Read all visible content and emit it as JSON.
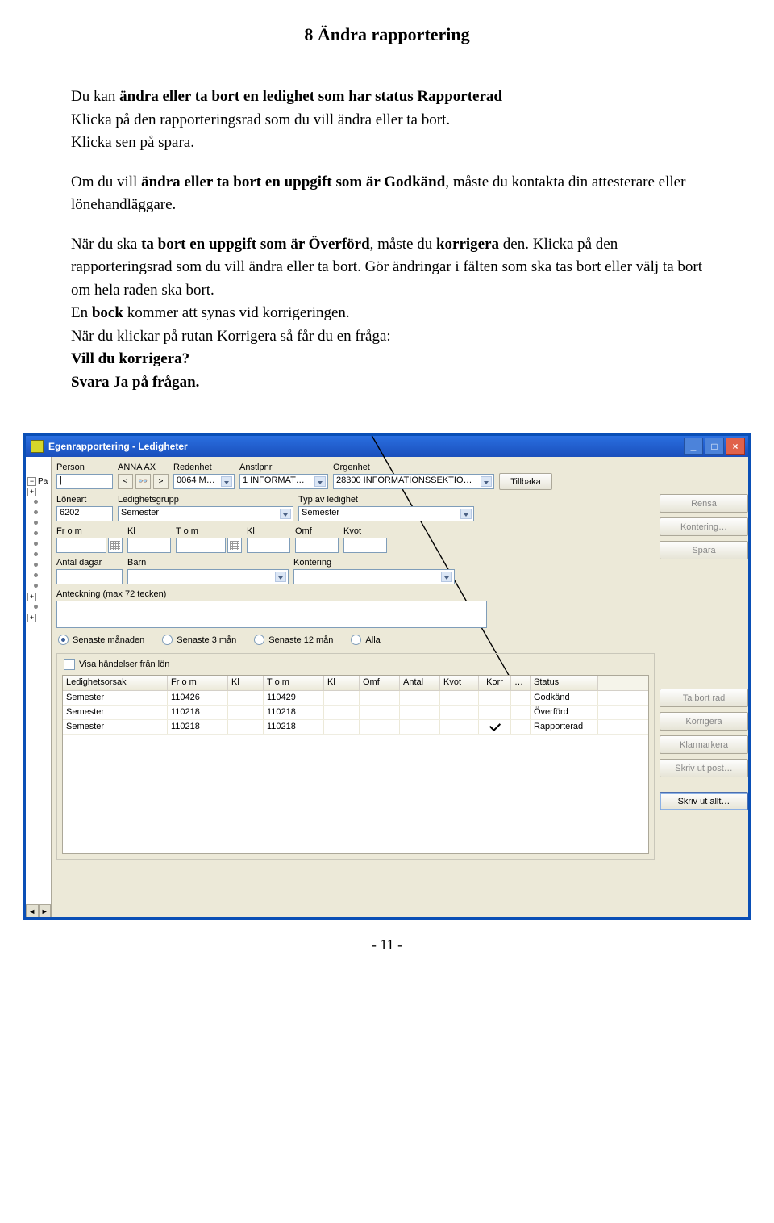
{
  "doc": {
    "heading": "8 Ändra rapportering",
    "p1a": "Du kan ",
    "p1b": "ändra eller ta bort en ledighet som har status Rapporterad",
    "p1c": "",
    "p2": "Klicka på den rapporteringsrad som du vill ändra eller ta bort.",
    "p3": "Klicka sen på spara.",
    "p4a": "Om du vill ",
    "p4b": "ändra eller ta bort en uppgift som är Godkänd",
    "p4c": ", måste du kontakta din attesterare eller lönehandläggare.",
    "p5a": "När du ska ",
    "p5b": "ta bort en uppgift som är Överförd",
    "p5c": ", måste du ",
    "p5d": "korrigera",
    "p5e": " den. Klicka på den rapporteringsrad som du vill ändra eller ta bort. Gör ändringar i fälten som ska tas bort eller välj ta bort om hela raden ska bort.",
    "p6a": "En ",
    "p6b": "bock",
    "p6c": " kommer att synas vid korrigeringen.",
    "p7": "När du klickar på rutan Korrigera så får du en fråga:",
    "p8": "Vill du korrigera?",
    "p9": "Svara Ja på frågan.",
    "footer": "- 11 -"
  },
  "app": {
    "title": "Egenrapportering - Ledigheter",
    "titlebar_icons": {
      "minimize": "_",
      "maximize": "□",
      "close": "×"
    },
    "toolbar": {
      "person_lbl": "Person",
      "person_val": "|",
      "anna": "ANNA AX",
      "prev": "<",
      "binoc": "🔍",
      "next": ">",
      "redenhet_lbl": "Redenhet",
      "redenhet_val": "0064  M…",
      "anstlpnr_lbl": "Anstlpnr",
      "anstlpnr_val": "1   INFORMAT…",
      "orgenhet_lbl": "Orgenhet",
      "orgenhet_val": "28300  INFORMATIONSSEKTIO…",
      "tillbaka": "Tillbaka"
    },
    "form": {
      "loneart_lbl": "Löneart",
      "loneart_val": "6202",
      "ledgrp_lbl": "Ledighetsgrupp",
      "ledgrp_val": "Semester",
      "typ_lbl": "Typ av ledighet",
      "typ_val": "Semester",
      "from_lbl": "Fr o m",
      "kl_lbl": "Kl",
      "tom_lbl": "T o m",
      "kl2_lbl": "Kl",
      "omf_lbl": "Omf",
      "kvot_lbl": "Kvot",
      "antal_lbl": "Antal dagar",
      "barn_lbl": "Barn",
      "kontering_lbl": "Kontering",
      "anteckning_lbl": "Anteckning (max 72 tecken)"
    },
    "radios": {
      "r1": "Senaste månaden",
      "r2": "Senaste 3 mån",
      "r3": "Senaste 12 mån",
      "r4": "Alla"
    },
    "check": "Visa händelser från lön",
    "table": {
      "headers": {
        "orsak": "Ledighetsorsak",
        "from": "Fr o m",
        "kl": "Kl",
        "tom": "T o m",
        "kl2": "Kl",
        "omf": "Omf",
        "antal": "Antal",
        "kvot": "Kvot",
        "korr": "Korr",
        "dots": "…",
        "status": "Status"
      },
      "rows": [
        {
          "orsak": "Semester",
          "from": "110426",
          "kl": "",
          "tom": "110429",
          "kl2": "",
          "omf": "",
          "antal": "",
          "kvot": "",
          "korr": "",
          "status": "Godkänd"
        },
        {
          "orsak": "Semester",
          "from": "110218",
          "kl": "",
          "tom": "110218",
          "kl2": "",
          "omf": "",
          "antal": "",
          "kvot": "",
          "korr": "",
          "status": "Överförd"
        },
        {
          "orsak": "Semester",
          "from": "110218",
          "kl": "",
          "tom": "110218",
          "kl2": "",
          "omf": "",
          "antal": "",
          "kvot": "",
          "korr": "✓",
          "status": "Rapporterad"
        }
      ]
    },
    "buttons": {
      "rensa": "Rensa",
      "kontering": "Kontering…",
      "spara": "Spara",
      "tabort": "Ta bort rad",
      "korrigera": "Korrigera",
      "klarmarkera": "Klarmarkera",
      "skrivpost": "Skriv ut post…",
      "skrivallt": "Skriv ut allt…"
    },
    "tree": {
      "root": "Pa",
      "plus": "+",
      "minus": "−"
    }
  }
}
